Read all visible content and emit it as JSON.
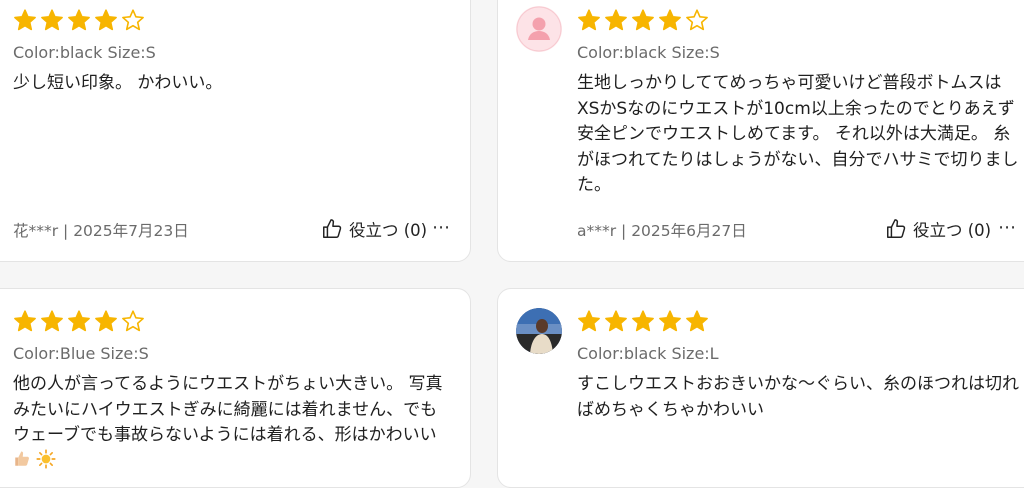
{
  "colors": {
    "star": "#f7b500",
    "text": "#1f1f1f",
    "meta": "#6b6b6b"
  },
  "reviews": [
    {
      "rating": 4,
      "variant": "Color:black Size:S",
      "text": "少し短い印象。 かわいい。",
      "author_date": "花***r | 2025年7月23日",
      "helpful_label": "役立つ (0)",
      "avatar": null
    },
    {
      "rating": 4,
      "variant": "Color:black Size:S",
      "text": "生地しっかりしててめっちゃ可愛いけど普段ボトムスはXSかSなのにウエストが10cm以上余ったのでとりあえず安全ピンでウエストしめてます。 それ以外は大満足。 糸がほつれてたりはしょうがない、自分でハサミで切りました。",
      "author_date": "a***r | 2025年6月27日",
      "helpful_label": "役立つ (0)",
      "avatar": "default-user-avatar"
    },
    {
      "rating": 4,
      "variant": "Color:Blue Size:S",
      "text": "他の人が言ってるようにウエストがちょい大きい。 写真みたいにハイウエストぎみに綺麗には着れません、でもウェーブでも事故らないようには着れる、形はかわいい",
      "emoji": [
        "thumbs-up-emoji",
        "sun-emoji"
      ],
      "avatar": null
    },
    {
      "rating": 5,
      "variant": "Color:black Size:L",
      "text": "すこしウエストおおきいかな〜ぐらい、糸のほつれは切ればめちゃくちゃかわいい",
      "avatar": "user-photo-avatar"
    }
  ]
}
